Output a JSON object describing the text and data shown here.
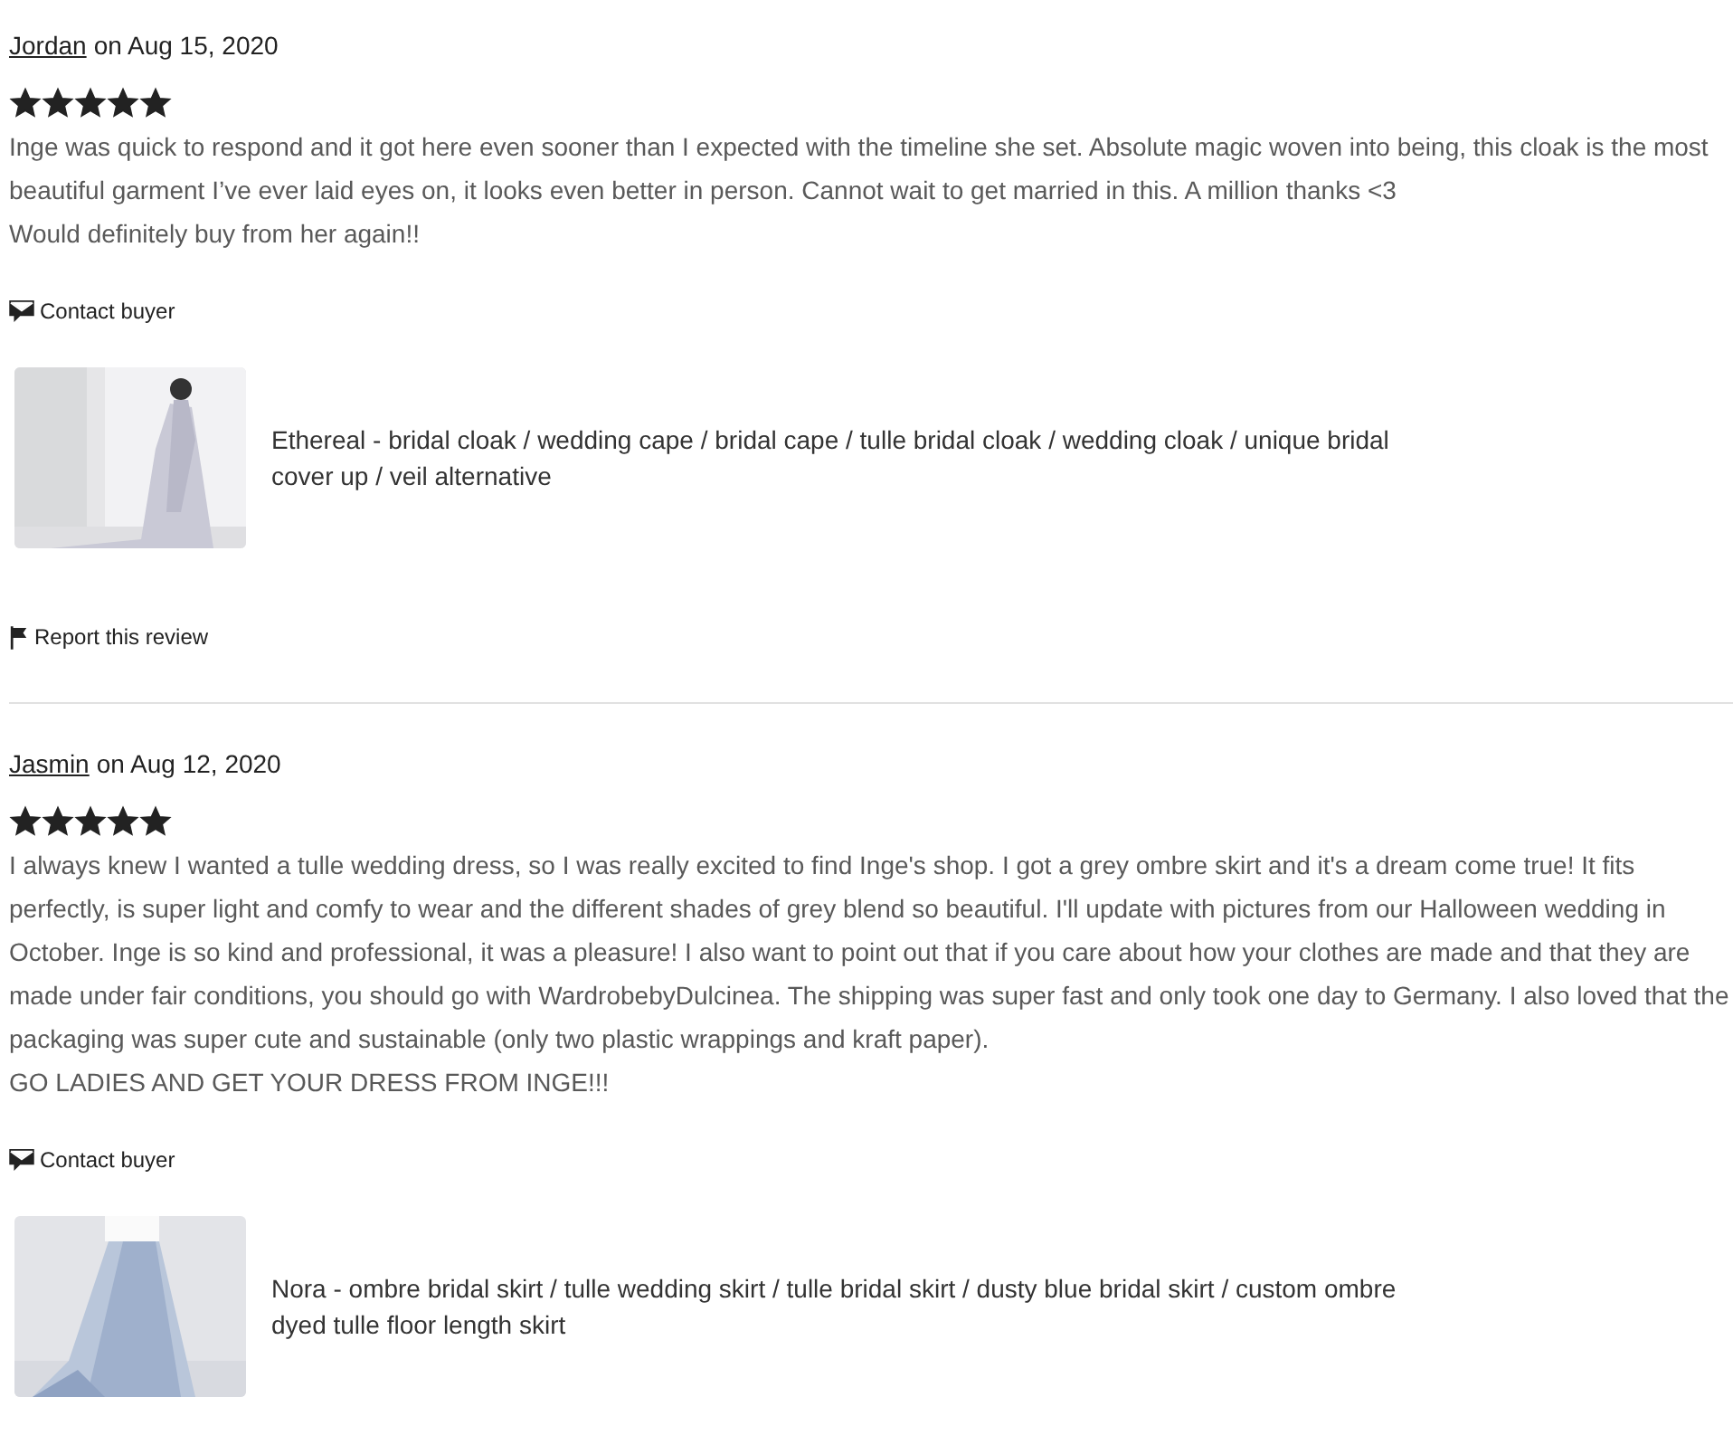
{
  "reviews": [
    {
      "author": "Jordan",
      "date": "on Aug 15, 2020",
      "stars": 5,
      "text": "Inge was quick to respond and it got here even sooner than I expected with the timeline she set. Absolute magic woven into being, this cloak is the most beautiful garment I’ve ever laid eyes on, it looks even better in person. Cannot wait to get married in this. A million thanks <3\nWould definitely buy from her again!!",
      "contact": "Contact buyer",
      "product": {
        "title": "Ethereal - bridal cloak / wedding cape / bridal cape / tulle bridal cloak / wedding cloak / unique bridal cover up / veil alternative"
      },
      "report": "Report this review"
    },
    {
      "author": "Jasmin",
      "date": "on Aug 12, 2020",
      "stars": 5,
      "text": "I always knew I wanted a tulle wedding dress, so I was really excited to find Inge's shop. I got a grey ombre skirt and it's a dream come true! It fits perfectly, is super light and comfy to wear and the different shades of grey blend so beautiful. I'll update with pictures from our Halloween wedding in October. Inge is so kind and professional, it was a pleasure! I also want to point out that if you care about how your clothes are made and that they are made under fair conditions, you should go with WardrobebyDulcinea. The shipping was super fast and only took one day to Germany. I also loved that the packaging was super cute and sustainable (only two plastic wrappings and kraft paper).\nGO LADIES AND GET YOUR DRESS FROM INGE!!!",
      "contact": "Contact buyer",
      "product": {
        "title": "Nora - ombre bridal skirt / tulle wedding skirt / tulle bridal skirt / dusty blue bridal skirt / custom ombre dyed tulle floor length skirt"
      }
    }
  ]
}
